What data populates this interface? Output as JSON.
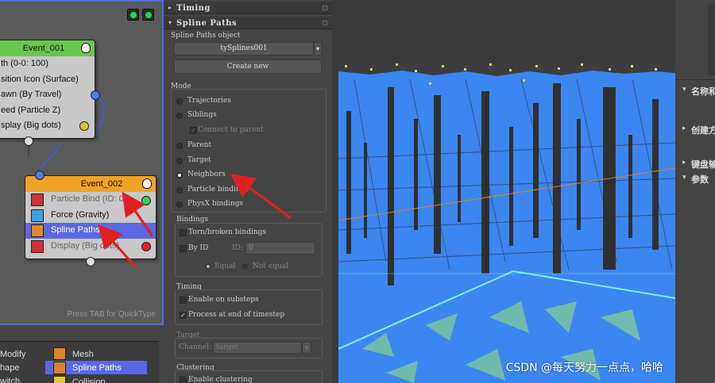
{
  "graph": {
    "quicktab_hint": "Press TAB for QuickType",
    "event1": {
      "title": "Event_001",
      "rows": [
        "th (0-0: 100)",
        "sition Icon (Surface)",
        "awn (By Travel)",
        "eed (Particle Z)",
        "splay (Big dots)"
      ]
    },
    "event2": {
      "title": "Event_002",
      "rows": [
        {
          "label": "Particle Bind (ID: 0)",
          "icon": "particle-bind-icon",
          "color": "#d34"
        },
        {
          "label": "Force (Gravity)",
          "icon": "force-icon",
          "color": "#3aa3e0"
        },
        {
          "label": "Spline Paths",
          "icon": "spline-paths-icon",
          "color": "#e08a2b"
        },
        {
          "label": "Display (Big dots)",
          "icon": "display-icon",
          "color": "#d34"
        }
      ]
    }
  },
  "depot": {
    "left": [
      "Modify",
      "hape",
      "witch"
    ],
    "right": [
      "Mesh",
      "Spline Paths",
      "Collision"
    ]
  },
  "panel": {
    "timing_header": "Timing",
    "spline_header": "Spline Paths",
    "object_label": "Spline Paths object",
    "object_value": "tySplines001",
    "create_new": "Create new",
    "mode_label": "Mode",
    "modes": [
      "Trajectories",
      "Siblings",
      "Parent",
      "Target",
      "Neighbors",
      "Particle bindings",
      "PhysX bindings"
    ],
    "connect_to_parent": "Connect to parent",
    "bindings_label": "Bindings",
    "torn_broken": "Torn/broken bindings",
    "by_id": "By ID",
    "id_label": "ID:",
    "id_value": "0",
    "equal": "Equal",
    "not_equal": "Not equal",
    "timing_label": "Timing",
    "enable_substeps": "Enable on substeps",
    "process_end": "Process at end of timestep",
    "target_label": "Target",
    "channel_label": "Channel:",
    "channel_value": "target",
    "clustering_label": "Clustering",
    "enable_clustering": "Enable clustering"
  },
  "cmd": {
    "rows": [
      "名称和",
      "创建方",
      "键盘输",
      "参数"
    ]
  },
  "viewport": {
    "watermark": "CSDN @每天努力一点点，哈哈"
  },
  "colors": {
    "water_blue": "#3c86f2",
    "selection": "#5b68e0",
    "annotation_red": "#e02020"
  }
}
